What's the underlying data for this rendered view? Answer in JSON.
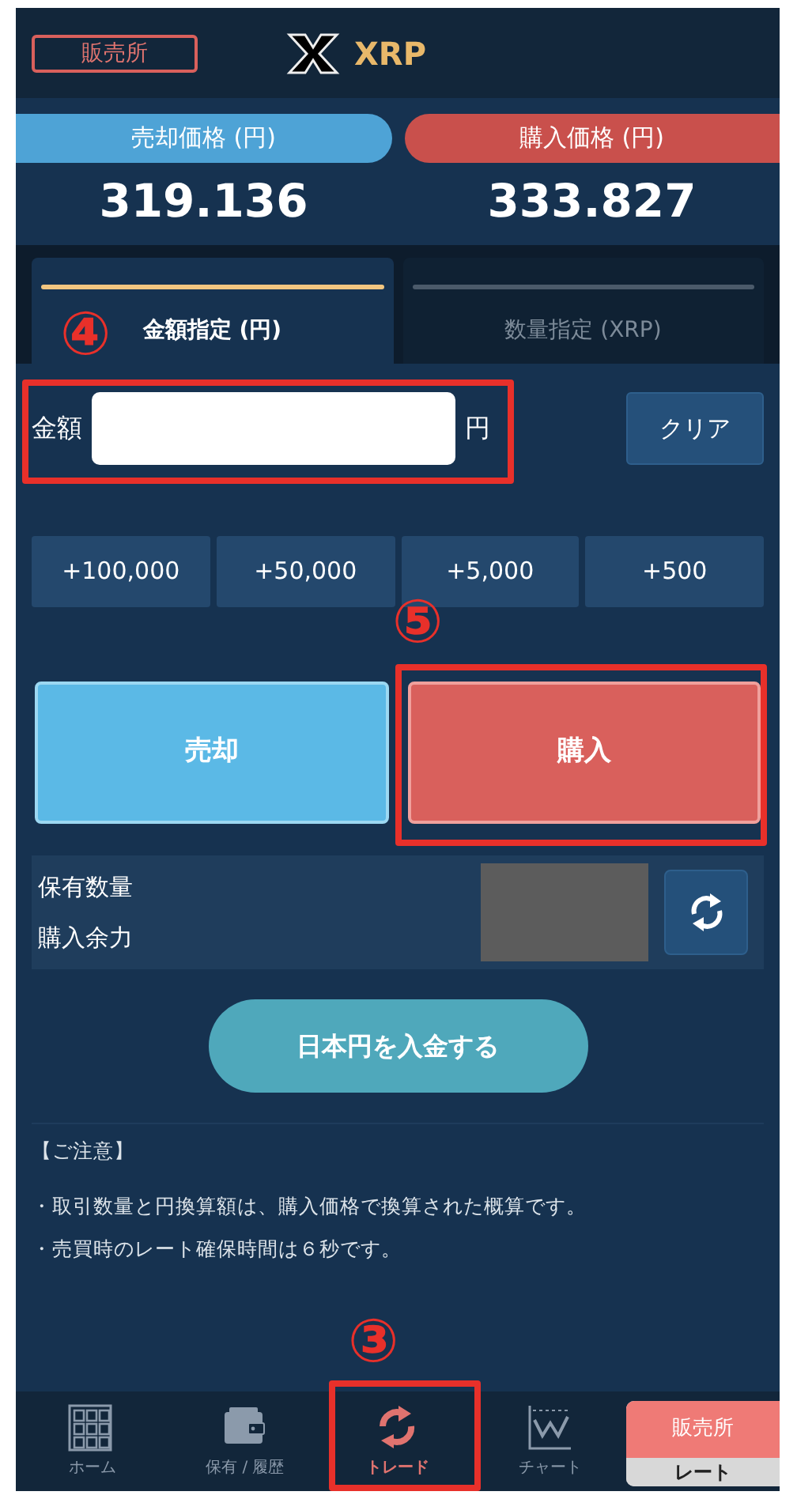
{
  "header": {
    "badge": "販売所",
    "title": "XRP"
  },
  "prices": [
    {
      "kind": "sell",
      "label": "売却価格 (円)",
      "value": "319.136"
    },
    {
      "kind": "buy",
      "label": "購入価格 (円)",
      "value": "333.827"
    }
  ],
  "tabs": [
    {
      "label": "金額指定 (円)",
      "selected": true
    },
    {
      "label": "数量指定 (XRP)",
      "selected": false
    }
  ],
  "amount": {
    "label": "金額",
    "unit": "円",
    "clear": "クリア"
  },
  "presets": [
    "+100,000",
    "+50,000",
    "+5,000",
    "+500"
  ],
  "actions": [
    {
      "kind": "sell",
      "label": "売却"
    },
    {
      "kind": "buy",
      "label": "購入"
    }
  ],
  "balance": {
    "rows": [
      "保有数量",
      "購入余力"
    ]
  },
  "deposit": "日本円を入金する",
  "notes": {
    "title": "【ご注意】",
    "items": [
      "・取引数量と円換算額は、購入価格で換算された概算です。",
      "・売買時のレート確保時間は６秒です。"
    ]
  },
  "nav": [
    {
      "kind": "home",
      "label": "ホーム",
      "selected": false
    },
    {
      "kind": "wallet",
      "label": "保有 / 履歴",
      "selected": false
    },
    {
      "kind": "trade",
      "label": "トレード",
      "selected": true
    },
    {
      "kind": "chart",
      "label": "チャート",
      "selected": false
    },
    {
      "kind": "rate",
      "label": "販売所",
      "sub": "レート",
      "selected": false
    }
  ],
  "annotations": [
    {
      "kind": "amount",
      "label": "④"
    },
    {
      "kind": "buy",
      "label": "⑤"
    },
    {
      "kind": "trade",
      "label": "③"
    }
  ]
}
